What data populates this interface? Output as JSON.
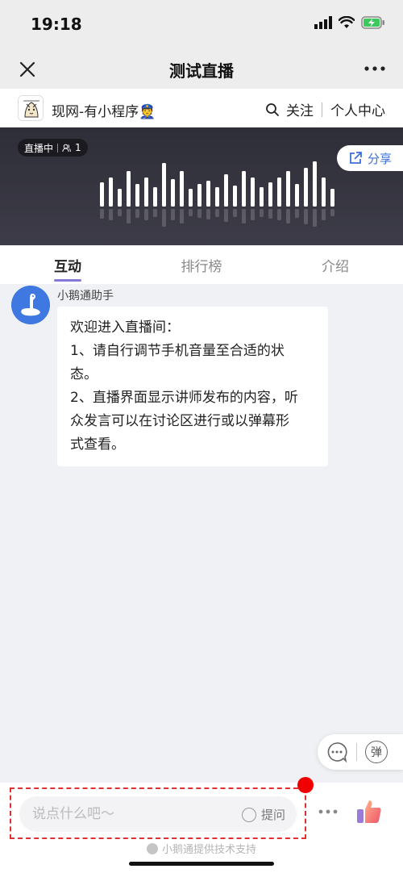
{
  "status_bar": {
    "time": "19:18"
  },
  "nav": {
    "title": "测试直播"
  },
  "channel": {
    "name": "现网-有小程序👮",
    "follow_label": "关注",
    "personal_center_label": "个人中心"
  },
  "live": {
    "status_label": "直播中",
    "viewer_count": "1",
    "share_label": "分享"
  },
  "tabs": [
    {
      "label": "互动",
      "active": true
    },
    {
      "label": "排行榜",
      "active": false
    },
    {
      "label": "介绍",
      "active": false
    }
  ],
  "message": {
    "sender": "小鹅通助手",
    "lines": [
      "欢迎进入直播间：",
      "1、请自行调节手机音量至合适的状",
      "态。",
      "2、直播界面显示讲师发布的内容，听",
      "众发言可以在讨论区进行或以弹幕形",
      "式查看。"
    ]
  },
  "float_actions": {
    "danmaku_label": "弹"
  },
  "input": {
    "placeholder": "说点什么吧～",
    "ask_label": "提问"
  },
  "footer": {
    "powered_by": "小鹅通提供技术支持"
  },
  "colors": {
    "accent_tab": "#8479d6",
    "share_blue": "#3c6fd6",
    "annotation_red": "#e23030",
    "avatar_blue": "#3f78e0"
  }
}
